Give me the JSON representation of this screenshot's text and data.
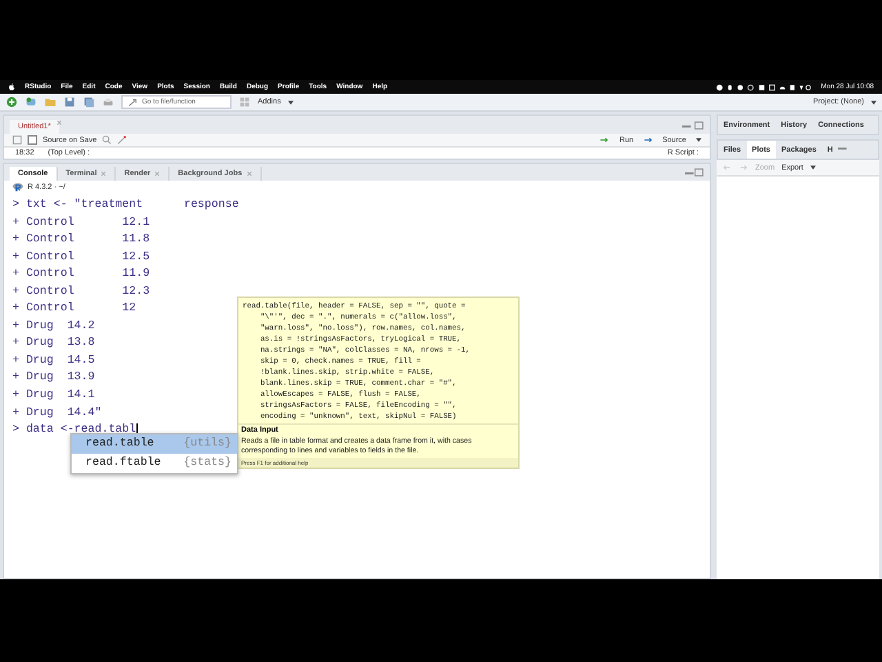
{
  "menu_bar": {
    "app": "RStudio",
    "items": [
      "File",
      "Edit",
      "Code",
      "View",
      "Plots",
      "Session",
      "Build",
      "Debug",
      "Profile",
      "Tools",
      "Window",
      "Help"
    ],
    "clock": "Mon 28 Jul 10:08"
  },
  "toolbar": {
    "goto_placeholder": "Go to file/function",
    "addins": "Addins",
    "project": "Project: (None)"
  },
  "editor": {
    "tabs": [
      {
        "label": "Untitled1*",
        "selected": true
      }
    ],
    "source_on_save": {
      "label": "Source on Save",
      "checked": false
    },
    "run": "Run",
    "source": "Source",
    "cursor_pos": "18:32",
    "scope": "(Top Level) :",
    "file_type": "R Script :"
  },
  "console": {
    "tabs": [
      {
        "label": "Console",
        "selected": true,
        "closable": false
      },
      {
        "label": "Terminal",
        "selected": false,
        "closable": true
      },
      {
        "label": "Render",
        "selected": false,
        "closable": true
      },
      {
        "label": "Background Jobs",
        "selected": false,
        "closable": true
      }
    ],
    "version": "R 4.3.2 · ~/",
    "lines": [
      {
        "prompt": ">",
        "text": "txt <- \"treatment      response"
      },
      {
        "prompt": "+",
        "text": "Control       12.1"
      },
      {
        "prompt": "+",
        "text": "Control       11.8"
      },
      {
        "prompt": "+",
        "text": "Control       12.5"
      },
      {
        "prompt": "+",
        "text": "Control       11.9"
      },
      {
        "prompt": "+",
        "text": "Control       12.3"
      },
      {
        "prompt": "+",
        "text": "Control       12"
      },
      {
        "prompt": "+",
        "text": "Drug  14.2"
      },
      {
        "prompt": "+",
        "text": "Drug  13.8"
      },
      {
        "prompt": "+",
        "text": "Drug  14.5"
      },
      {
        "prompt": "+",
        "text": "Drug  13.9"
      },
      {
        "prompt": "+",
        "text": "Drug  14.1"
      },
      {
        "prompt": "+",
        "text": "Drug  14.4\""
      },
      {
        "prompt": ">",
        "text": "data <-read.tabl"
      }
    ]
  },
  "tooltip": {
    "signature": "read.table(file, header = FALSE, sep = \"\", quote =\n    \"\\\"'\", dec = \".\", numerals = c(\"allow.loss\",\n    \"warn.loss\", \"no.loss\"), row.names, col.names,\n    as.is = !stringsAsFactors, tryLogical = TRUE,\n    na.strings = \"NA\", colClasses = NA, nrows = -1,\n    skip = 0, check.names = TRUE, fill =\n    !blank.lines.skip, strip.white = FALSE,\n    blank.lines.skip = TRUE, comment.char = \"#\",\n    allowEscapes = FALSE, flush = FALSE,\n    stringsAsFactors = FALSE, fileEncoding = \"\",\n    encoding = \"unknown\", text, skipNul = FALSE)",
    "title": "Data Input",
    "description": "Reads a file in table format and creates a data frame from it, with cases corresponding to lines and variables to fields in the file.",
    "hint": "Press F1 for additional help"
  },
  "completions": [
    {
      "name": "read.table",
      "package": "{utils}",
      "selected": true
    },
    {
      "name": "read.ftable",
      "package": "{stats}",
      "selected": false
    }
  ],
  "env_pane": {
    "tabs": [
      {
        "label": "Environment",
        "selected": false
      },
      {
        "label": "History",
        "selected": false
      },
      {
        "label": "Connections",
        "selected": false
      }
    ]
  },
  "files_pane": {
    "tabs": [
      {
        "label": "Files",
        "selected": false
      },
      {
        "label": "Plots",
        "selected": true
      },
      {
        "label": "Packages",
        "selected": false
      },
      {
        "label": "H",
        "selected": false
      }
    ],
    "zoom": "Zoom",
    "export": "Export"
  }
}
